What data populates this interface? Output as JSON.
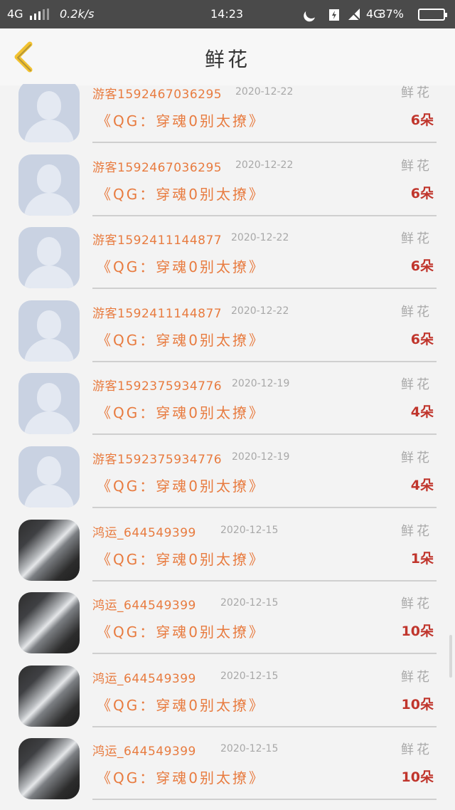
{
  "status_bar": {
    "network_left": "4G",
    "speed": "0.2k/s",
    "time": "14:23",
    "network_right": "4G",
    "battery_percent": "37%"
  },
  "header": {
    "title": "鲜花",
    "back_icon": "chevron-left-icon",
    "accent": "#f2c230"
  },
  "list": {
    "items": [
      {
        "name": "游客1592467036295",
        "date": "2020-12-22",
        "label": "鲜花",
        "book": "《QG：穿魂0别太撩》",
        "count": "6朵",
        "avatar": "default"
      },
      {
        "name": "游客1592467036295",
        "date": "2020-12-22",
        "label": "鲜花",
        "book": "《QG：穿魂0别太撩》",
        "count": "6朵",
        "avatar": "default"
      },
      {
        "name": "游客1592411144877",
        "date": "2020-12-22",
        "label": "鲜花",
        "book": "《QG：穿魂0别太撩》",
        "count": "6朵",
        "avatar": "default"
      },
      {
        "name": "游客1592411144877",
        "date": "2020-12-22",
        "label": "鲜花",
        "book": "《QG：穿魂0别太撩》",
        "count": "6朵",
        "avatar": "default"
      },
      {
        "name": "游客1592375934776",
        "date": "2020-12-19",
        "label": "鲜花",
        "book": "《QG：穿魂0别太撩》",
        "count": "4朵",
        "avatar": "default"
      },
      {
        "name": "游客1592375934776",
        "date": "2020-12-19",
        "label": "鲜花",
        "book": "《QG：穿魂0别太撩》",
        "count": "4朵",
        "avatar": "default"
      },
      {
        "name": "鸿运_644549399",
        "date": "2020-12-15",
        "label": "鲜花",
        "book": "《QG：穿魂0别太撩》",
        "count": "1朵",
        "avatar": "photo"
      },
      {
        "name": "鸿运_644549399",
        "date": "2020-12-15",
        "label": "鲜花",
        "book": "《QG：穿魂0别太撩》",
        "count": "10朵",
        "avatar": "photo"
      },
      {
        "name": "鸿运_644549399",
        "date": "2020-12-15",
        "label": "鲜花",
        "book": "《QG：穿魂0别太撩》",
        "count": "10朵",
        "avatar": "photo"
      },
      {
        "name": "鸿运_644549399",
        "date": "2020-12-15",
        "label": "鲜花",
        "book": "《QG：穿魂0别太撩》",
        "count": "10朵",
        "avatar": "photo"
      }
    ]
  },
  "colors": {
    "name": "#e87b3f",
    "count": "#c0352c",
    "muted": "#a8a8a8",
    "status_bar": "#4a4a4a"
  }
}
